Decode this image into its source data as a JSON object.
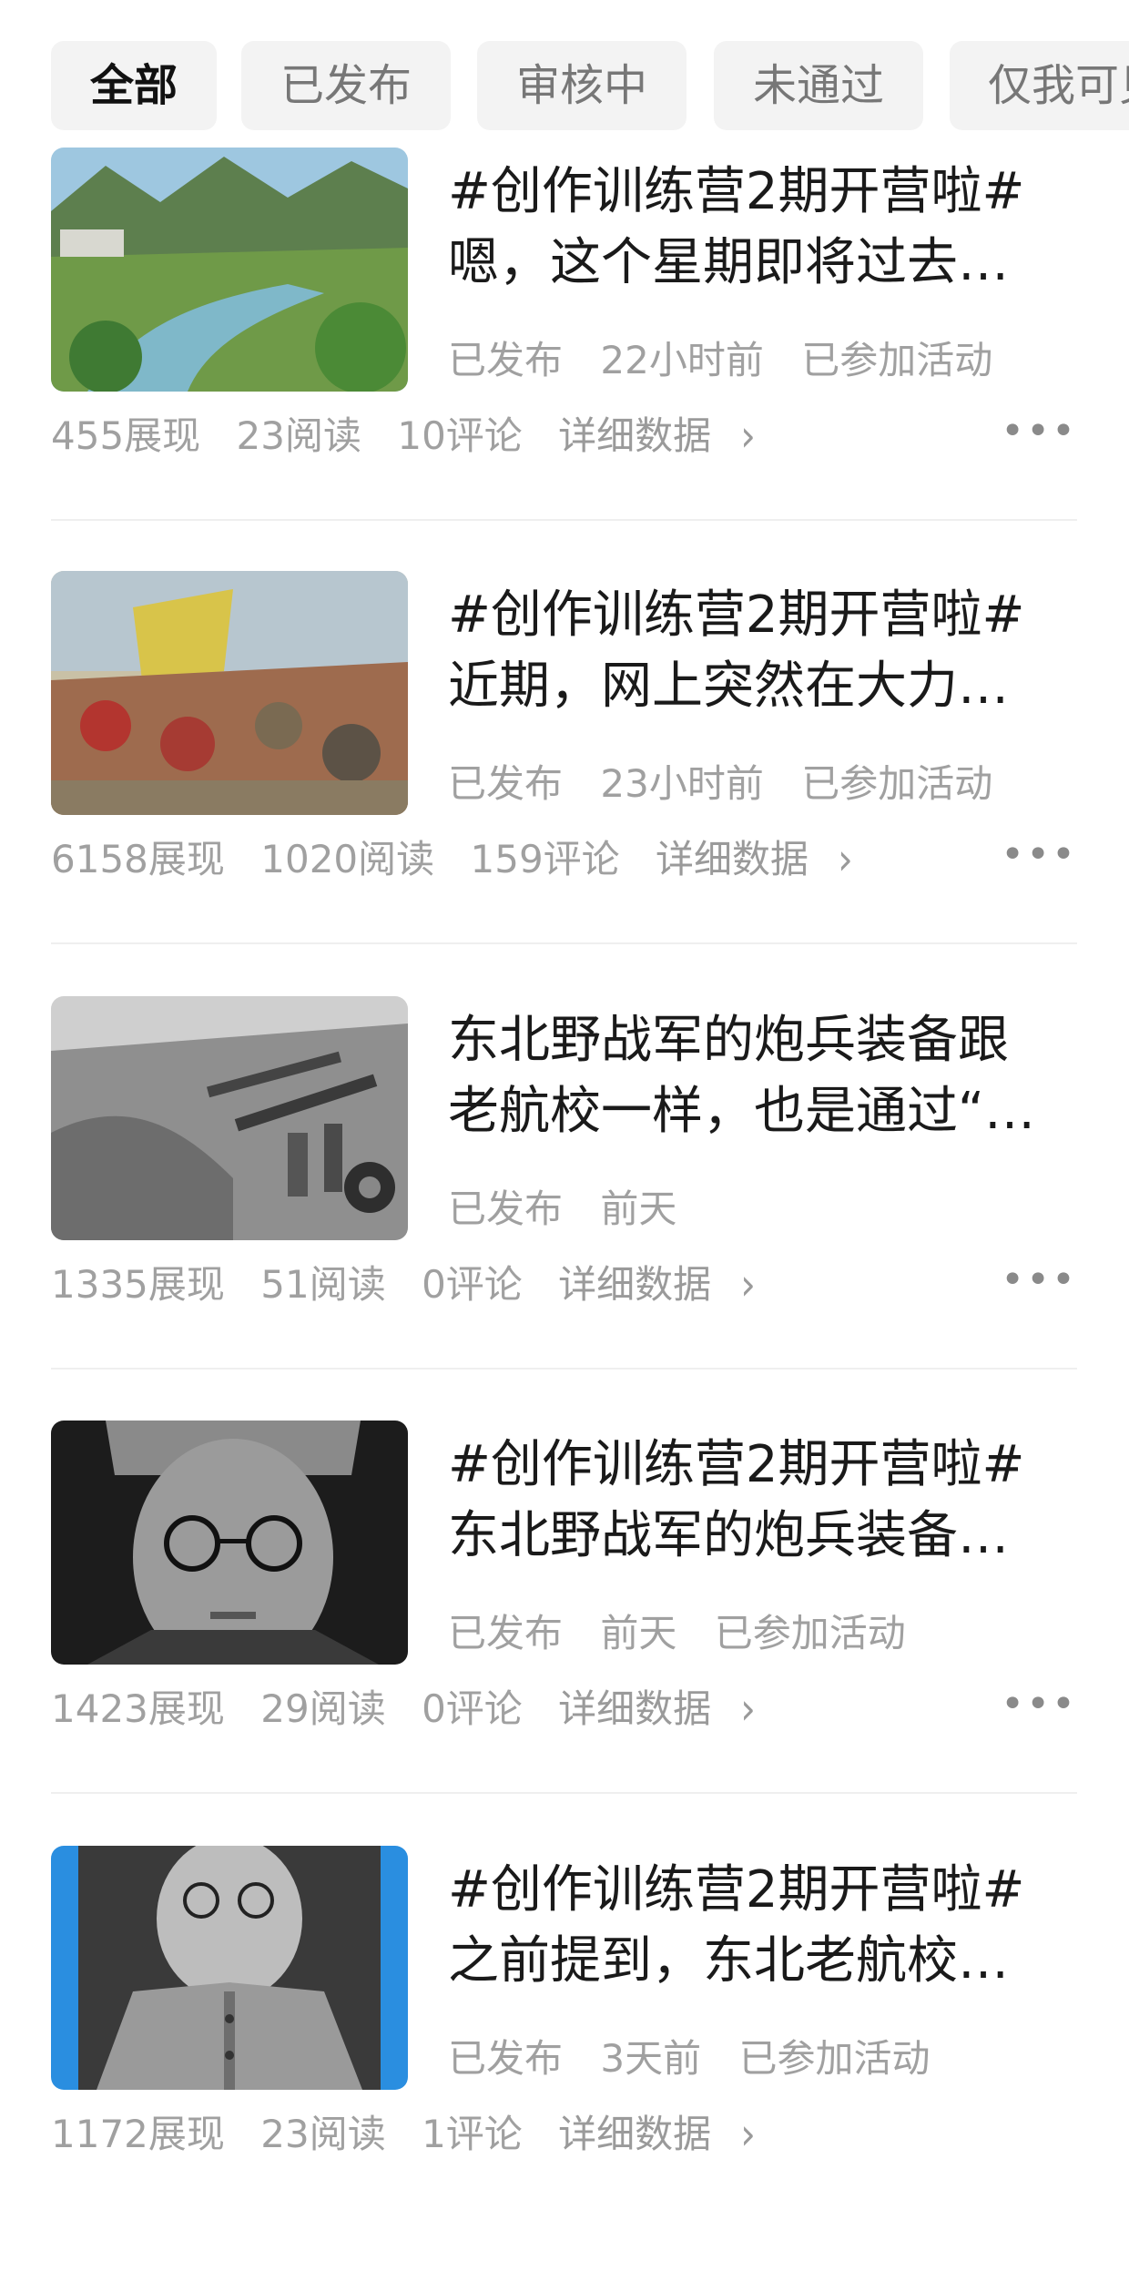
{
  "tabs": [
    "全部",
    "已发布",
    "审核中",
    "未通过",
    "仅我可见"
  ],
  "items": [
    {
      "title_line1": "#创作训练营2期开营啦#",
      "title_line2": "嗯，这个星期即将过去…",
      "status": "已发布",
      "time": "22小时前",
      "activity": "已参加活动",
      "views": "455展现",
      "reads": "23阅读",
      "comments": "10评论",
      "detail": "详细数据",
      "thumb": "river-landscape-image"
    },
    {
      "title_line1": "#创作训练营2期开营啦#",
      "title_line2": "近期，网上突然在大力…",
      "status": "已发布",
      "time": "23小时前",
      "activity": "已参加活动",
      "views": "6158展现",
      "reads": "1020阅读",
      "comments": "159评论",
      "detail": "详细数据",
      "thumb": "battle-painting-image"
    },
    {
      "title_line1": "东北野战军的炮兵装备跟",
      "title_line2": "老航校一样，也是通过“…",
      "status": "已发布",
      "time": "前天",
      "activity": "",
      "views": "1335展现",
      "reads": "51阅读",
      "comments": "0评论",
      "detail": "详细数据",
      "thumb": "artillery-photo-image"
    },
    {
      "title_line1": "#创作训练营2期开营啦#",
      "title_line2": "东北野战军的炮兵装备…",
      "status": "已发布",
      "time": "前天",
      "activity": "已参加活动",
      "views": "1423展现",
      "reads": "29阅读",
      "comments": "0评论",
      "detail": "详细数据",
      "thumb": "portrait-glasses-image"
    },
    {
      "title_line1": "#创作训练营2期开营啦#",
      "title_line2": "之前提到，东北老航校…",
      "status": "已发布",
      "time": "3天前",
      "activity": "已参加活动",
      "views": "1172展现",
      "reads": "23阅读",
      "comments": "1评论",
      "detail": "详细数据",
      "thumb": "portrait-uniform-image"
    }
  ],
  "more_glyph": "•••",
  "chevron_glyph": "›"
}
